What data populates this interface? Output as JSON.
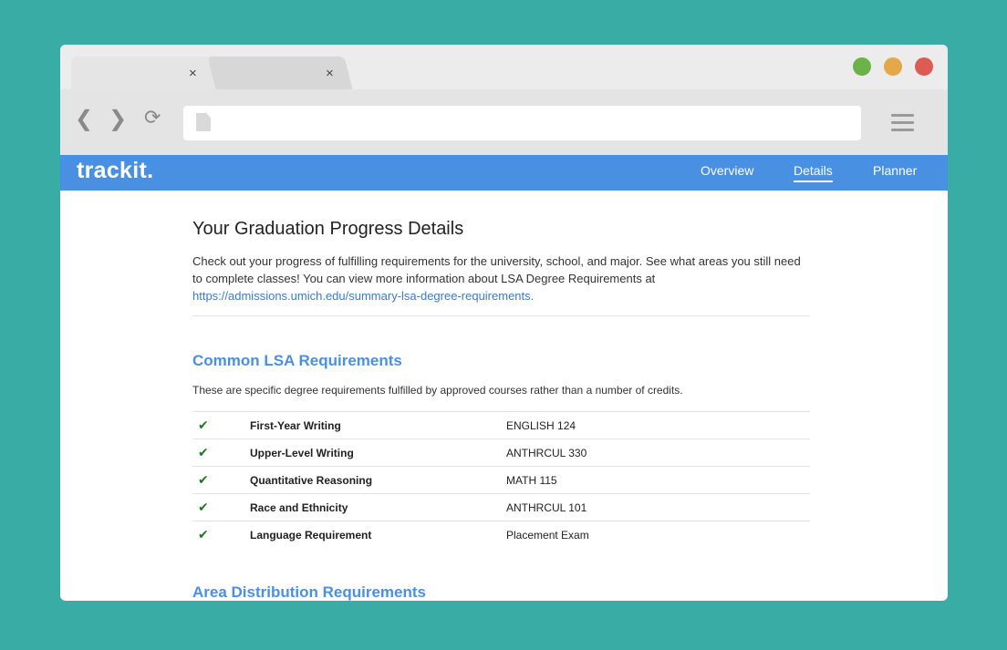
{
  "browser": {
    "tabs": [
      {
        "close_label": "×"
      },
      {
        "close_label": "×"
      }
    ],
    "traffic_lights": {
      "green": "#6cb24a",
      "yellow": "#e2a84a",
      "red": "#dc5b52"
    }
  },
  "app": {
    "logo": "trackit.",
    "nav": [
      {
        "label": "Overview"
      },
      {
        "label": "Details",
        "active": true
      },
      {
        "label": "Planner"
      }
    ]
  },
  "page": {
    "title": "Your Graduation Progress Details",
    "intro": "Check out your progress of fulfilling requirements for the university, school, and major. See what areas you still need to complete classes! You can view more information about LSA Degree Requirements at",
    "intro_link": "https://admissions.umich.edu/summary-lsa-degree-requirements."
  },
  "common_requirements": {
    "title": "Common LSA Requirements",
    "description": "These are specific degree requirements fulfilled by approved courses rather than a number of credits.",
    "rows": [
      {
        "check": "✔",
        "name": "First-Year Writing",
        "course": "ENGLISH 124"
      },
      {
        "check": "✔",
        "name": "Upper-Level Writing",
        "course": "ANTHRCUL 330"
      },
      {
        "check": "✔",
        "name": "Quantitative Reasoning",
        "course": "MATH 115"
      },
      {
        "check": "✔",
        "name": "Race and Ethnicity",
        "course": "ANTHRCUL 101"
      },
      {
        "check": "✔",
        "name": "Language Requirement",
        "course": "Placement Exam"
      }
    ]
  },
  "area_requirements": {
    "title": "Area Distribution Requirements"
  },
  "colors": {
    "background": "#3aaca6",
    "brand": "#4a90e2",
    "check": "#1e7a1e"
  }
}
